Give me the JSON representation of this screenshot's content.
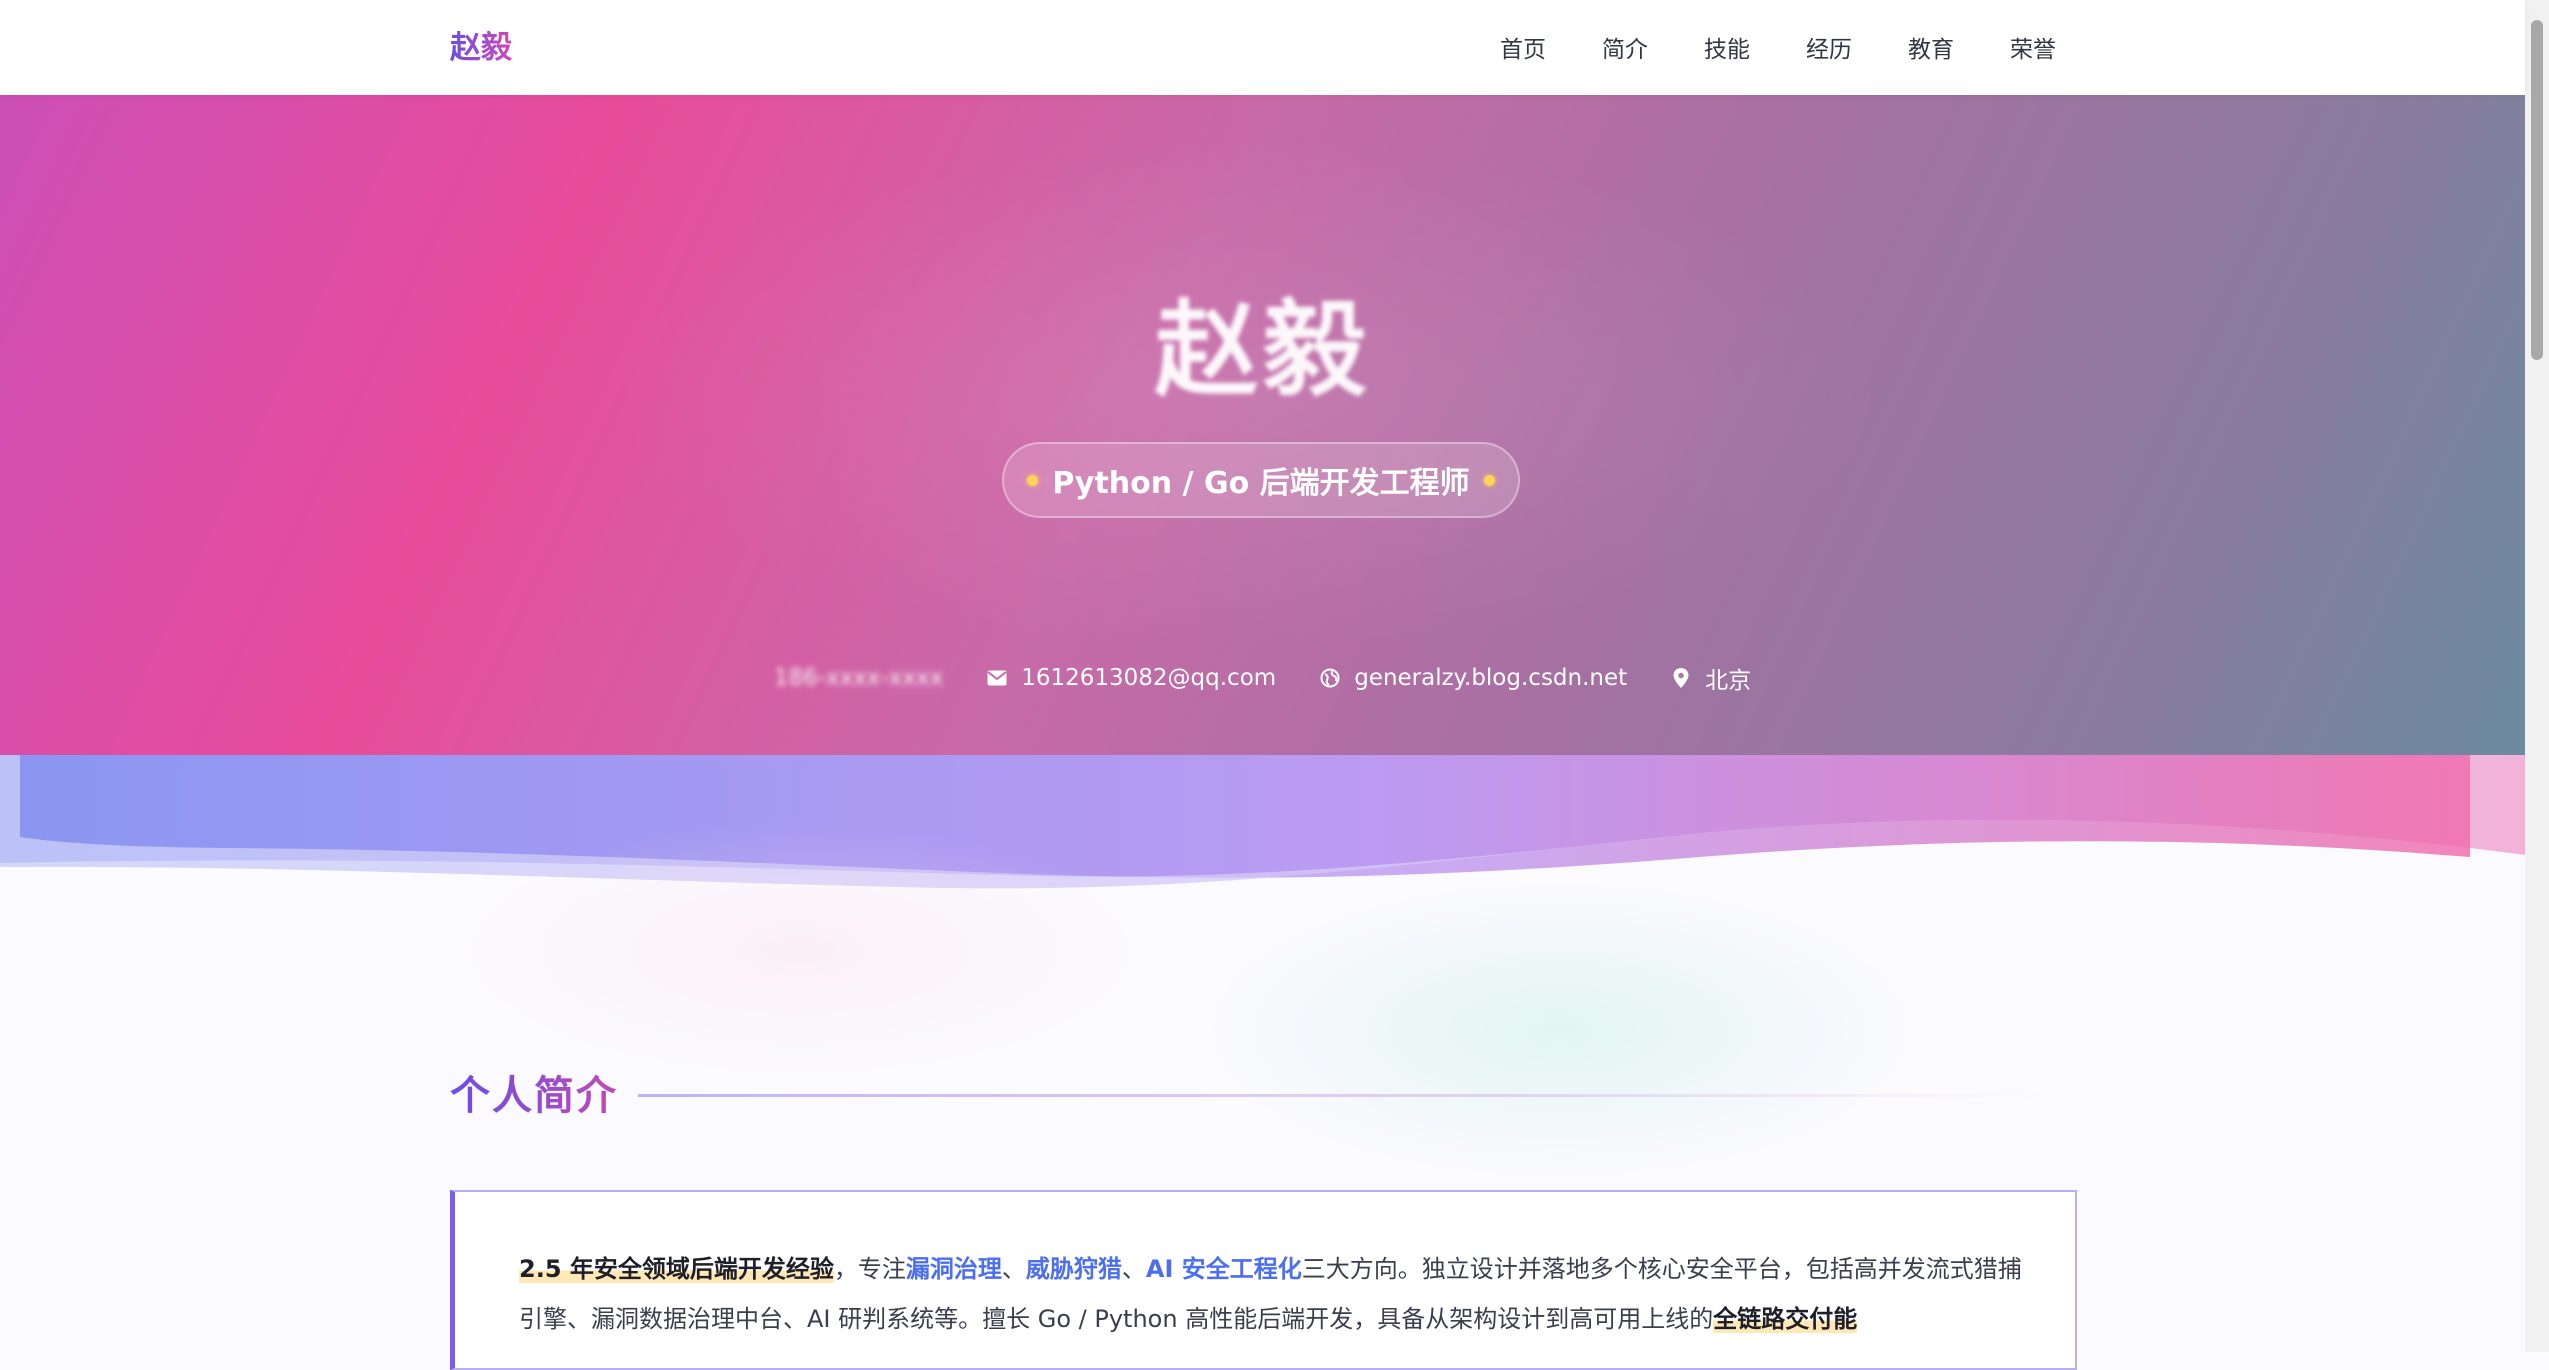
{
  "nav": {
    "brand": "赵毅",
    "links": [
      "首页",
      "简介",
      "技能",
      "经历",
      "教育",
      "荣誉"
    ]
  },
  "hero": {
    "name": "赵毅",
    "role": "Python / Go 后端开发工程师",
    "contacts": {
      "phone": "186-xxxx-xxxx",
      "email": "1612613082@qq.com",
      "blog": "generalzy.blog.csdn.net",
      "location": "北京"
    }
  },
  "about": {
    "title": "个人简介",
    "intro": {
      "highlight1": "2.5 年安全领域后端开发经验",
      "sep1": "，专注",
      "kw1": "漏洞治理",
      "sep2": "、",
      "kw2": "威胁狩猎",
      "sep3": "、",
      "kw3": "AI 安全工程化",
      "text1": "三大方向。独立设计并落地多个核心安全平台，包括高并发流式猎捕引擎、漏洞数据治理中台、AI 研判系统等。擅长 Go / Python 高性能后端开发，具备从架构设计到高可用上线的",
      "highlight2": "全链路交付能"
    }
  },
  "colors": {
    "accent": "#7a5cf0",
    "keyword": "#4c6ef0",
    "highlight_bg": "#ffe8b5",
    "pill_dot": "#ffd25a"
  },
  "icons": {
    "email": "mail-icon",
    "blog": "globe-icon",
    "location": "pin-icon"
  }
}
